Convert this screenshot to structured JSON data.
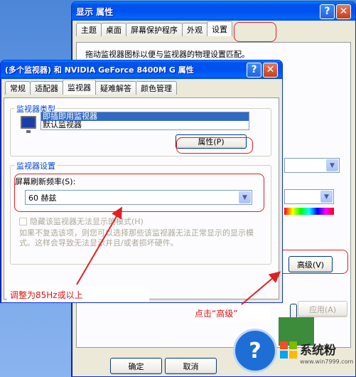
{
  "back_window": {
    "title": "显示 属性",
    "tabs": [
      "主题",
      "桌面",
      "屏幕保护程序",
      "外观",
      "设置"
    ],
    "active_tab": "设置",
    "hint": "拖动监视器图标以便与监视器的物理设置匹配。",
    "advanced_button": "高级(V)",
    "apply_button": "应用(A)",
    "ok_button": "确定",
    "cancel_button": "取消"
  },
  "front_window": {
    "title": "(多个监视器) 和 NVIDIA GeForce 8400M G 属性",
    "tabs": [
      "常规",
      "适配器",
      "监视器",
      "疑难解答",
      "颜色管理"
    ],
    "active_tab": "监视器",
    "monitor_type": {
      "label": "监视器类型",
      "items": [
        "即插即用监视器",
        "默认监视器"
      ],
      "selected": "即插即用监视器",
      "properties_button": "属性(P)"
    },
    "monitor_settings": {
      "label": "监视器设置",
      "refresh_label": "屏幕刷新频率(S):",
      "refresh_value": "60 赫兹",
      "hide_modes_label": "隐藏该监视器无法显示的模式(H)",
      "hide_modes_checked": false,
      "description": "如果不复选该项，则您可以选择那些该监视器无法正常显示的显示模式。这样会导致无法显示并且/或者损坏硬件。"
    }
  },
  "annotations": {
    "left_note": "调整为85Hz或以上",
    "right_note": "点击“高级”"
  },
  "watermark": {
    "brand": "系统粉",
    "url": "www.win7999.com"
  },
  "colors": {
    "annotation_red": "#e02020",
    "xp_title_blue": "#0053ee",
    "selection_blue": "#316ac5"
  }
}
